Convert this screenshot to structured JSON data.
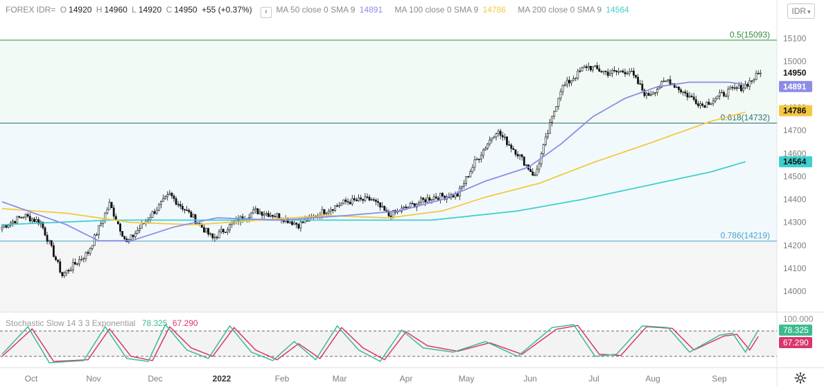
{
  "header": {
    "symbol": "FOREX IDR=",
    "open_label": "O",
    "open": "14920",
    "high_label": "H",
    "high": "14960",
    "low_label": "L",
    "low": "14920",
    "close_label": "C",
    "close": "14950",
    "change": "+55 (+0.37%)",
    "ma50_label": "MA 50 close 0 SMA 9",
    "ma50_value": "14891",
    "ma100_label": "MA 100 close 0 SMA 9",
    "ma100_value": "14786",
    "ma200_label": "MA 200 close 0 SMA 9",
    "ma200_value": "14564"
  },
  "currency_selector": {
    "label": "IDR",
    "icon": "chevron-down-icon"
  },
  "collapse_icon": "chevron-left-icon",
  "colors": {
    "up": "#ffffff",
    "down": "#111111",
    "ma50": "#8c8ce6",
    "ma100": "#f5c842",
    "ma200": "#3ecfcf",
    "stoch_k": "#3dbb8e",
    "stoch_d": "#d9366b",
    "fib_green": "#2e8b3a",
    "fib_teal": "#2a6f73",
    "fib_blue": "#4aa3c7"
  },
  "chart_data": {
    "type": "candlestick",
    "yaxis_ticks": [
      15100,
      15000,
      14900,
      14800,
      14700,
      14600,
      14500,
      14400,
      14300,
      14200,
      14100,
      14000
    ],
    "ylim": [
      13910,
      15180
    ],
    "x_ticks": [
      "Oct",
      "Nov",
      "Dec",
      "2022",
      "Feb",
      "Mar",
      "Apr",
      "May",
      "Jun",
      "Jul",
      "Aug",
      "Sep"
    ],
    "fib_levels": [
      {
        "label": "0.5(15093)",
        "value": 15093
      },
      {
        "label": "0.618(14732)",
        "value": 14732
      },
      {
        "label": "0.786(14219)",
        "value": 14219
      }
    ],
    "price_tags": [
      {
        "value": "14950",
        "style": "last"
      },
      {
        "value": "14891",
        "style": "ma50"
      },
      {
        "value": "14786",
        "style": "ma100"
      },
      {
        "value": "14564",
        "style": "ma200"
      }
    ],
    "close_anchors": [
      [
        0,
        14280
      ],
      [
        10,
        14330
      ],
      [
        18,
        14300
      ],
      [
        28,
        14070
      ],
      [
        40,
        14170
      ],
      [
        50,
        14380
      ],
      [
        58,
        14210
      ],
      [
        68,
        14320
      ],
      [
        78,
        14420
      ],
      [
        88,
        14330
      ],
      [
        98,
        14230
      ],
      [
        108,
        14300
      ],
      [
        118,
        14350
      ],
      [
        128,
        14330
      ],
      [
        138,
        14290
      ],
      [
        150,
        14350
      ],
      [
        160,
        14390
      ],
      [
        172,
        14400
      ],
      [
        180,
        14330
      ],
      [
        192,
        14380
      ],
      [
        200,
        14410
      ],
      [
        212,
        14420
      ],
      [
        220,
        14560
      ],
      [
        230,
        14700
      ],
      [
        240,
        14600
      ],
      [
        248,
        14500
      ],
      [
        260,
        14880
      ],
      [
        272,
        14980
      ],
      [
        282,
        14950
      ],
      [
        292,
        14960
      ],
      [
        300,
        14850
      ],
      [
        310,
        14920
      ],
      [
        318,
        14860
      ],
      [
        326,
        14810
      ],
      [
        338,
        14870
      ],
      [
        345,
        14890
      ],
      [
        353,
        14950
      ]
    ],
    "ma50_anchors": [
      [
        0,
        14390
      ],
      [
        30,
        14290
      ],
      [
        45,
        14220
      ],
      [
        60,
        14220
      ],
      [
        80,
        14280
      ],
      [
        100,
        14320
      ],
      [
        130,
        14310
      ],
      [
        160,
        14330
      ],
      [
        185,
        14350
      ],
      [
        205,
        14400
      ],
      [
        225,
        14480
      ],
      [
        245,
        14540
      ],
      [
        260,
        14640
      ],
      [
        275,
        14760
      ],
      [
        290,
        14840
      ],
      [
        305,
        14890
      ],
      [
        320,
        14910
      ],
      [
        338,
        14910
      ],
      [
        346,
        14900
      ]
    ],
    "ma100_anchors": [
      [
        0,
        14360
      ],
      [
        30,
        14340
      ],
      [
        60,
        14300
      ],
      [
        90,
        14290
      ],
      [
        120,
        14310
      ],
      [
        150,
        14330
      ],
      [
        180,
        14320
      ],
      [
        205,
        14350
      ],
      [
        225,
        14410
      ],
      [
        250,
        14470
      ],
      [
        275,
        14560
      ],
      [
        300,
        14640
      ],
      [
        318,
        14700
      ],
      [
        330,
        14740
      ],
      [
        346,
        14780
      ]
    ],
    "ma200_anchors": [
      [
        0,
        14290
      ],
      [
        50,
        14310
      ],
      [
        100,
        14310
      ],
      [
        150,
        14310
      ],
      [
        200,
        14310
      ],
      [
        240,
        14350
      ],
      [
        270,
        14400
      ],
      [
        300,
        14460
      ],
      [
        330,
        14520
      ],
      [
        346,
        14564
      ]
    ],
    "stochastic": {
      "label": "Stochastic Slow 14 3 3 Exponential",
      "k_value": "78.325",
      "d_value": "67.290",
      "yaxis_top": "100.000",
      "upper_band": 80,
      "lower_band": 20,
      "k_anchors": [
        [
          0,
          25
        ],
        [
          12,
          90
        ],
        [
          22,
          5
        ],
        [
          38,
          10
        ],
        [
          48,
          90
        ],
        [
          58,
          15
        ],
        [
          68,
          8
        ],
        [
          76,
          95
        ],
        [
          86,
          35
        ],
        [
          96,
          15
        ],
        [
          106,
          92
        ],
        [
          116,
          30
        ],
        [
          126,
          10
        ],
        [
          136,
          55
        ],
        [
          146,
          12
        ],
        [
          156,
          92
        ],
        [
          166,
          35
        ],
        [
          176,
          8
        ],
        [
          186,
          82
        ],
        [
          196,
          40
        ],
        [
          210,
          30
        ],
        [
          225,
          55
        ],
        [
          240,
          20
        ],
        [
          256,
          88
        ],
        [
          266,
          95
        ],
        [
          276,
          20
        ],
        [
          286,
          25
        ],
        [
          298,
          92
        ],
        [
          310,
          88
        ],
        [
          320,
          30
        ],
        [
          334,
          70
        ],
        [
          340,
          75
        ],
        [
          346,
          30
        ],
        [
          352,
          82
        ]
      ],
      "d_anchors": [
        [
          0,
          20
        ],
        [
          14,
          85
        ],
        [
          24,
          8
        ],
        [
          40,
          12
        ],
        [
          50,
          85
        ],
        [
          60,
          20
        ],
        [
          70,
          10
        ],
        [
          78,
          90
        ],
        [
          88,
          40
        ],
        [
          98,
          20
        ],
        [
          108,
          88
        ],
        [
          118,
          35
        ],
        [
          128,
          12
        ],
        [
          138,
          50
        ],
        [
          148,
          15
        ],
        [
          158,
          88
        ],
        [
          168,
          40
        ],
        [
          178,
          12
        ],
        [
          188,
          78
        ],
        [
          198,
          45
        ],
        [
          212,
          32
        ],
        [
          227,
          52
        ],
        [
          242,
          25
        ],
        [
          258,
          84
        ],
        [
          268,
          93
        ],
        [
          278,
          25
        ],
        [
          288,
          22
        ],
        [
          300,
          90
        ],
        [
          312,
          86
        ],
        [
          322,
          35
        ],
        [
          336,
          68
        ],
        [
          342,
          72
        ],
        [
          348,
          35
        ],
        [
          352,
          67
        ]
      ]
    }
  }
}
